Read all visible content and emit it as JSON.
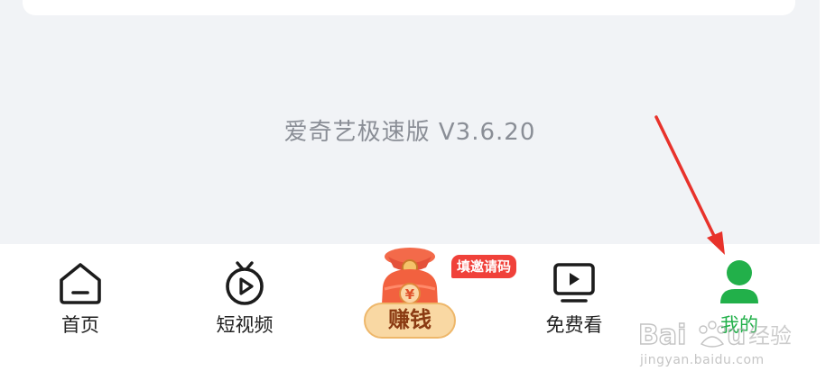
{
  "content": {
    "version_text": "爱奇艺极速版 V3.6.20"
  },
  "tab_bar": {
    "tabs": [
      {
        "label": "首页",
        "icon": "home-icon"
      },
      {
        "label": "短视频",
        "icon": "short-video-icon"
      },
      {
        "label": "赚钱",
        "icon": "money-bag-icon",
        "badge": "填邀请码"
      },
      {
        "label": "免费看",
        "icon": "free-watch-icon"
      },
      {
        "label": "我的",
        "icon": "user-icon",
        "active": true
      }
    ]
  },
  "colors": {
    "active": "#22b04a",
    "badge": "#f0413a",
    "arrow": "#e8322b",
    "background": "#f1f3f6"
  },
  "watermark": {
    "brand": "Baidu经验",
    "url": "jingyan.baidu.com"
  }
}
